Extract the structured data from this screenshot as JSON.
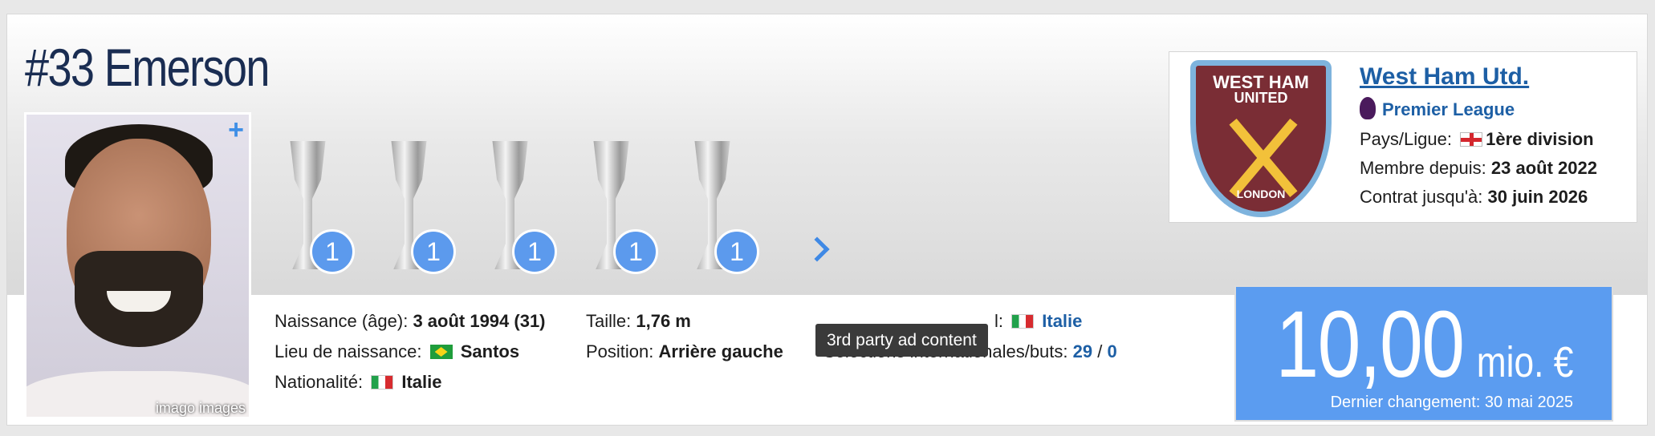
{
  "player": {
    "name": "#33 Emerson",
    "photo_credit": "imago images",
    "photo_plus": "+"
  },
  "trophies": [
    {
      "icon": "european-championship-trophy-icon",
      "count": "1"
    },
    {
      "icon": "champions-league-trophy-icon",
      "count": "1"
    },
    {
      "icon": "uefa-super-cup-trophy-icon",
      "count": "1"
    },
    {
      "icon": "europa-league-trophy-icon",
      "count": "1"
    },
    {
      "icon": "conference-league-trophy-icon",
      "count": "1"
    }
  ],
  "info": {
    "birth_label": "Naissance (âge):",
    "birth_value": "3 août 1994 (31)",
    "birthplace_label": "Lieu de naissance:",
    "birthplace_value": "Santos",
    "nationality_label": "Nationalité:",
    "nationality_value": "Italie",
    "height_label": "Taille:",
    "height_value": "1,76 m",
    "position_label": "Position:",
    "position_value": "Arrière gauche",
    "national_team_label_suffix": "l:",
    "national_team_value": "Italie",
    "caps_label": "Sélections internationales/buts:",
    "caps_value": "29",
    "caps_sep": "/",
    "goals_value": "0"
  },
  "tooltip": "3rd party ad content",
  "club": {
    "crest_line1": "WEST HAM",
    "crest_line2": "UNITED",
    "crest_line3": "LONDON",
    "name": "West Ham Utd.",
    "league": "Premier League",
    "country_label": "Pays/Ligue:",
    "country_value": "1ère division",
    "since_label": "Membre depuis:",
    "since_value": "23 août 2022",
    "contract_label": "Contrat jusqu'à:",
    "contract_value": "30 juin 2026"
  },
  "market_value": {
    "amount": "10,00",
    "unit": "mio. €",
    "last_change": "Dernier changement: 30 mai 2025"
  },
  "colors": {
    "title": "#1a2d52",
    "link": "#1d5fa5",
    "value_bg": "#5b9cf0",
    "badge": "#5c9aed"
  }
}
